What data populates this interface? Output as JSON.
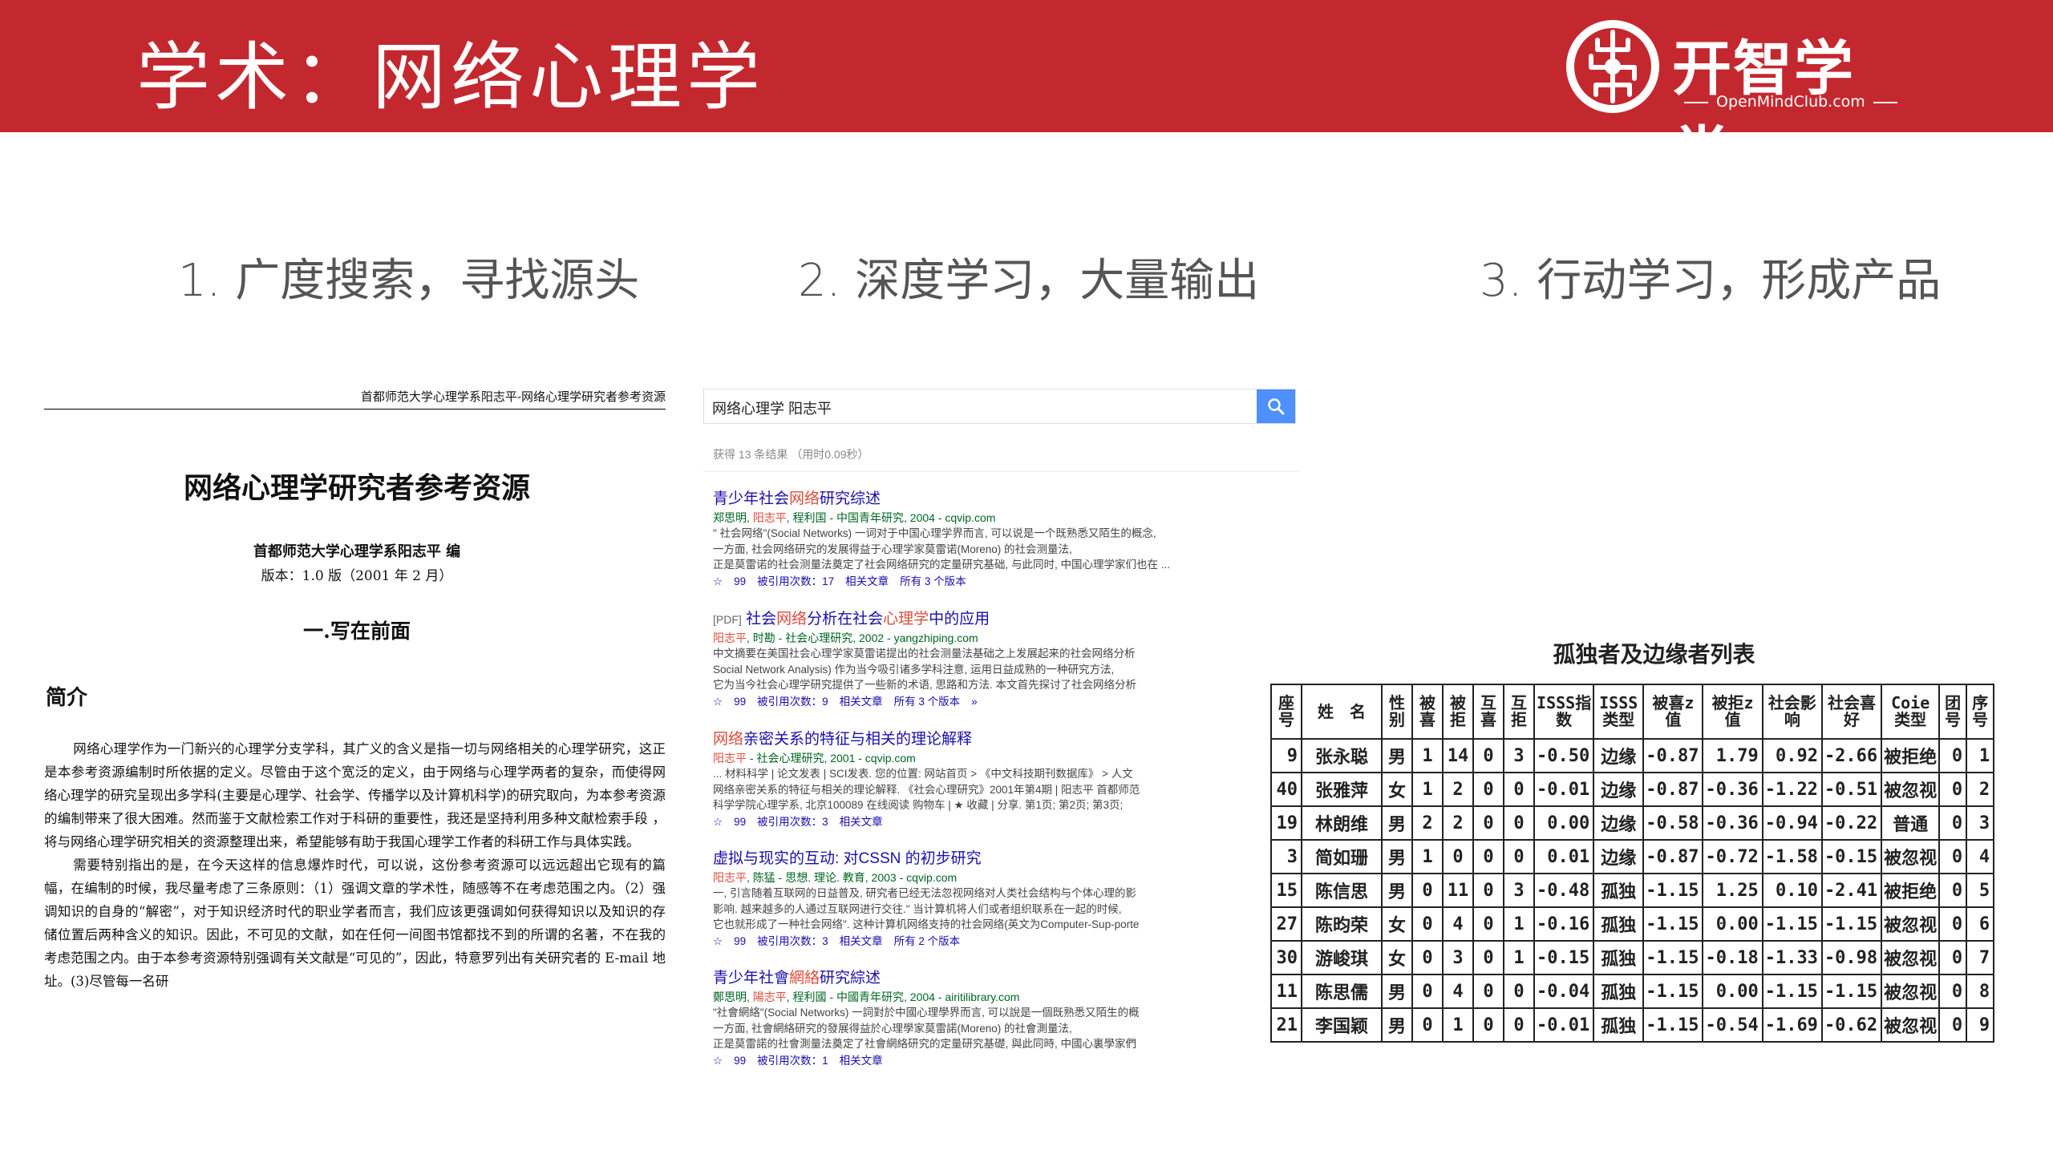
{
  "header": {
    "title": "学术：网络心理学",
    "brand_name": "开智学堂",
    "brand_url": "OpenMindClub.com",
    "bg_color": "#c4282f"
  },
  "steps": [
    {
      "label": "1. 广度搜索，寻找源头"
    },
    {
      "label": "2. 深度学习，大量输出"
    },
    {
      "label": "3. 行动学习，形成产品"
    }
  ],
  "document": {
    "running_header": "首都师范大学心理学系阳志平-网络心理学研究者参考资源",
    "title": "网络心理学研究者参考资源",
    "author": "首都师范大学心理学系阳志平  编",
    "version": "版本：1.0 版（2001 年 2 月）",
    "section": "一.写在前面",
    "intro_heading": "简介",
    "paragraphs": [
      "网络心理学作为一门新兴的心理学分支学科，其广义的含义是指一切与网络相关的心理学研究，这正是本参考资源编制时所依据的定义。尽管由于这个宽泛的定义，由于网络与心理学两者的复杂，而使得网络心理学的研究呈现出多学科(主要是心理学、社会学、传播学以及计算机科学)的研究取向，为本参考资源的编制带来了很大困难。然而鉴于文献检索工作对于科研的重要性，我还是坚持利用多种文献检索手段 ，将与网络心理学研究相关的资源整理出来，希望能够有助于我国心理学工作者的科研工作与具体实践。",
      "需要特别指出的是，在今天这样的信息爆炸时代，可以说，这份参考资源可以远远超出它现有的篇幅，在编制的时候，我尽量考虑了三条原则：（1）强调文章的学术性，随感等不在考虑范围之内。（2）强调知识的自身的“解密”，对于知识经济时代的职业学者而言，我们应该更强调如何获得知识以及知识的存储位置后两种含义的知识。因此，不可见的文献，如在任何一间图书馆都找不到的所谓的名著，不在我的考虑范围之内。由于本参考资源特别强调有关文献是“可见的”，因此，特意罗列出有关研究者的 E-mail 地址。(3)尽管每一名研"
    ]
  },
  "search": {
    "query": "网络心理学 阳志平",
    "stats": "获得 13 条结果  （用时0.09秒）",
    "results": [
      {
        "pre": "",
        "t1": "青少年社会",
        "h1": "网络",
        "t2": "研究综述",
        "h2": "",
        "t3": "",
        "cite_a": "郑思明, ",
        "cite_h": "阳志平",
        "cite_b": ", 程利国 - 中国青年研究, 2004 - cqvip.com",
        "snippet": [
          "\" 社会网络\"(Social Networks) 一词对于中国心理学界而言, 可以说是一个既熟悉又陌生的概念,",
          "一方面, 社会网络研究的发展得益于心理学家莫雷诺(Moreno) 的社会测量法,",
          "正是莫雷诺的社会测量法奠定了社会网络研究的定量研究基础, 与此同时, 中国心理学家们也在 ..."
        ],
        "links": [
          "☆",
          "99",
          "被引用次数：17",
          "相关文章",
          "所有 3 个版本"
        ]
      },
      {
        "pre": "[PDF]",
        "t1": "社会",
        "h1": "网络",
        "t2": "分析在社会",
        "h2": "心理学",
        "t3": "中的应用",
        "cite_a": "",
        "cite_h": "阳志平",
        "cite_b": ", 时勘 - 社会心理研究, 2002 - yangzhiping.com",
        "snippet": [
          "中文摘要在美国社会心理学家莫雷诺提出的社会测量法基础之上发展起来的社会网络分析",
          "Social Network Analysis) 作为当今吸引诸多学科注意, 运用日益成熟的一种研究方法,",
          "它为当今社会心理学研究提供了一些新的术语, 思路和方法. 本文首先探讨了社会网络分析"
        ],
        "links": [
          "☆",
          "99",
          "被引用次数：9",
          "相关文章",
          "所有 3 个版本",
          "»"
        ]
      },
      {
        "pre": "",
        "t1": "",
        "h1": "网络",
        "t2": "亲密关系的特征与相关的理论解释",
        "h2": "",
        "t3": "",
        "cite_a": "",
        "cite_h": "阳志平",
        "cite_b": " - 社会心理研究, 2001 - cqvip.com",
        "snippet": [
          "... 材料科学 | 论文发表 | SCI发表. 您的位置: 网站首页 > 《中文科技期刊数据库》 > 人文",
          "网络亲密关系的特征与相关的理论解释. 《社会心理研究》2001年第4期 | 阳志平 首都师范",
          "科学学院心理学系, 北京100089 在线阅读 购物车 | ★ 收藏 | 分享. 第1页; 第2页; 第3页;"
        ],
        "links": [
          "☆",
          "99",
          "被引用次数：3",
          "相关文章"
        ]
      },
      {
        "pre": "",
        "t1": "虚拟与现实的互动: 对CSSN 的初步研究",
        "h1": "",
        "t2": "",
        "h2": "",
        "t3": "",
        "cite_a": "",
        "cite_h": "阳志平",
        "cite_b": ", 陈猛 - 思想. 理论. 教育, 2003 - cqvip.com",
        "snippet": [
          "一, 引言随着互联网的日益普及, 研究者已经无法忽视网络对人类社会结构与个体心理的影",
          "影响. 越来越多的人通过互联网进行交往.\" 当计算机将人们或者组织联系在一起的时候,",
          "它也就形成了一种社会网络\". 这种计算机网络支持的社会网络(英文为Computer-Sup-porte"
        ],
        "links": [
          "☆",
          "99",
          "被引用次数：3",
          "相关文章",
          "所有 2 个版本"
        ]
      },
      {
        "pre": "",
        "t1": "青少年社會",
        "h1": "網絡",
        "t2": "研究綜述",
        "h2": "",
        "t3": "",
        "cite_a": "鄭思明, ",
        "cite_h": "陽志平",
        "cite_b": ", 程利國 - 中國青年研究, 2004 - airitilibrary.com",
        "snippet": [
          "\"社會網絡\"(Social Networks) 一詞對於中國心理學界而言, 可以說是一個既熟悉又陌生的概",
          "一方面, 社會網絡研究的發展得益於心理學家莫雷諾(Moreno) 的社會測量法,",
          "正是莫雷諾的社會測量法奠定了社會網絡研究的定量研究基礎, 與此同時, 中國心裏學家們"
        ],
        "links": [
          "☆",
          "99",
          "被引用次数：1",
          "相关文章"
        ]
      }
    ]
  },
  "table": {
    "title": "孤独者及边缘者列表",
    "headers": [
      "座号",
      "姓　名",
      "性别",
      "被喜",
      "被拒",
      "互喜",
      "互拒",
      "ISSS指数",
      "ISSS类型",
      "被喜z值",
      "被拒z值",
      "社会影响",
      "社会喜好",
      "Coie类型",
      "团号",
      "序号"
    ],
    "rows": [
      [
        "9",
        "张永聪",
        "男",
        "1",
        "14",
        "0",
        "3",
        "-0.50",
        "边缘",
        "-0.87",
        "1.79",
        "0.92",
        "-2.66",
        "被拒绝",
        "0",
        "1"
      ],
      [
        "40",
        "张雅萍",
        "女",
        "1",
        "2",
        "0",
        "0",
        "-0.01",
        "边缘",
        "-0.87",
        "-0.36",
        "-1.22",
        "-0.51",
        "被忽视",
        "0",
        "2"
      ],
      [
        "19",
        "林朗维",
        "男",
        "2",
        "2",
        "0",
        "0",
        "0.00",
        "边缘",
        "-0.58",
        "-0.36",
        "-0.94",
        "-0.22",
        "普通",
        "0",
        "3"
      ],
      [
        "3",
        "简如珊",
        "男",
        "1",
        "0",
        "0",
        "0",
        "0.01",
        "边缘",
        "-0.87",
        "-0.72",
        "-1.58",
        "-0.15",
        "被忽视",
        "0",
        "4"
      ],
      [
        "15",
        "陈信思",
        "男",
        "0",
        "11",
        "0",
        "3",
        "-0.48",
        "孤独",
        "-1.15",
        "1.25",
        "0.10",
        "-2.41",
        "被拒绝",
        "0",
        "5"
      ],
      [
        "27",
        "陈昀荣",
        "女",
        "0",
        "4",
        "0",
        "1",
        "-0.16",
        "孤独",
        "-1.15",
        "0.00",
        "-1.15",
        "-1.15",
        "被忽视",
        "0",
        "6"
      ],
      [
        "30",
        "游峻琪",
        "女",
        "0",
        "3",
        "0",
        "1",
        "-0.15",
        "孤独",
        "-1.15",
        "-0.18",
        "-1.33",
        "-0.98",
        "被忽视",
        "0",
        "7"
      ],
      [
        "11",
        "陈思儒",
        "男",
        "0",
        "4",
        "0",
        "0",
        "-0.04",
        "孤独",
        "-1.15",
        "0.00",
        "-1.15",
        "-1.15",
        "被忽视",
        "0",
        "8"
      ],
      [
        "21",
        "李国颖",
        "男",
        "0",
        "1",
        "0",
        "0",
        "-0.01",
        "孤独",
        "-1.15",
        "-0.54",
        "-1.69",
        "-0.62",
        "被忽视",
        "0",
        "9"
      ]
    ]
  }
}
